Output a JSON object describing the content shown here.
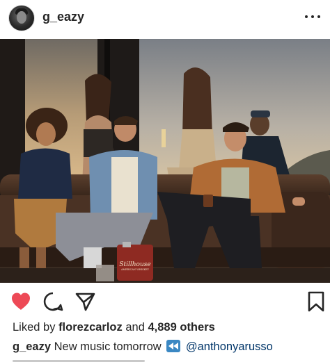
{
  "header": {
    "username": "g_eazy",
    "avatar_icon": "profile-avatar",
    "more_icon": "more-options-icon"
  },
  "post": {
    "image_description_icon": "party-photo",
    "flask_label_main": "Stillhouse",
    "flask_label_sub": "AMERICAN WHISKEY"
  },
  "actions": {
    "like_icon": "heart-icon",
    "comment_icon": "comment-icon",
    "share_icon": "send-icon",
    "save_icon": "bookmark-icon",
    "liked": true,
    "like_color": "#ed4956"
  },
  "likes": {
    "prefix": "Liked by",
    "user": "florezcarloz",
    "joiner": "and",
    "others": "4,889 others"
  },
  "caption": {
    "username": "g_eazy",
    "text": "New music tomorrow",
    "emoji_icon": "rewind-emoji-icon",
    "mention": "@anthonyarusso"
  },
  "colors": {
    "text": "#262626",
    "mention": "#003569",
    "heart": "#ed4956"
  }
}
